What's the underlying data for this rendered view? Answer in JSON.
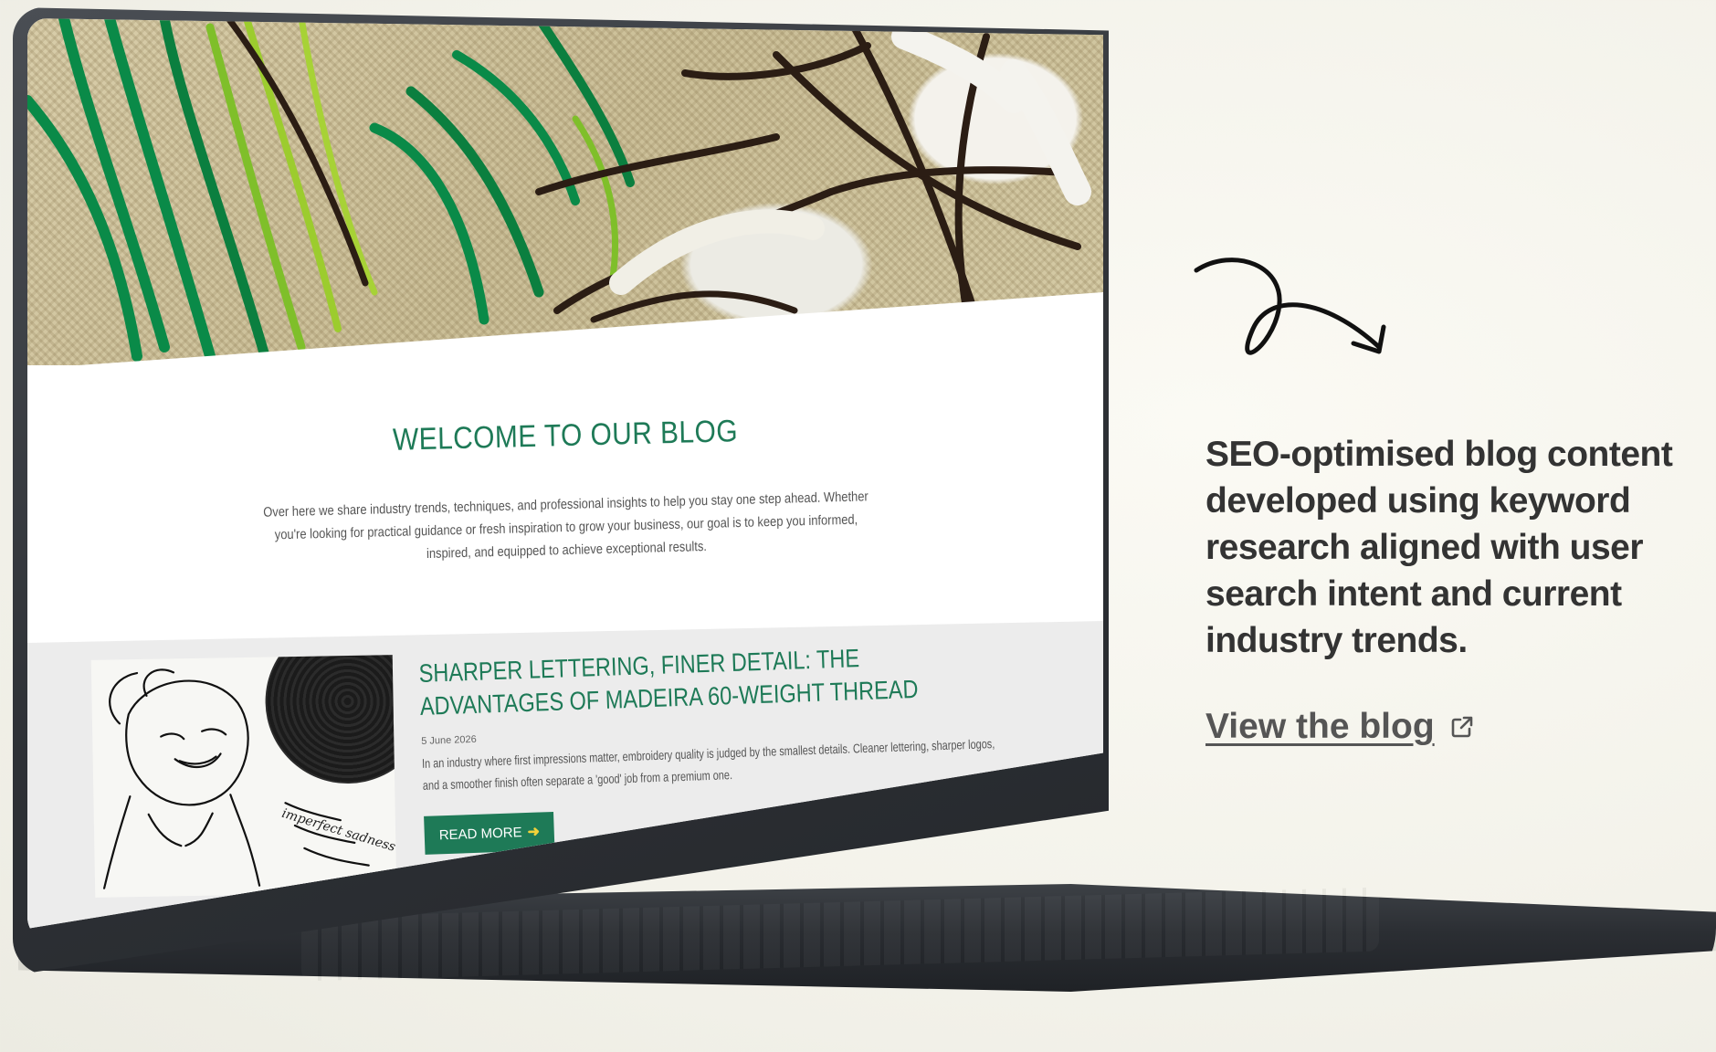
{
  "blog_page": {
    "welcome_title": "WELCOME TO OUR BLOG",
    "welcome_text": "Over here we share industry trends, techniques, and professional insights to help you stay one step ahead. Whether you're looking for practical guidance or fresh inspiration to grow your business, our goal is to keep you informed, inspired, and equipped to achieve exceptional results.",
    "post": {
      "title": "SHARPER LETTERING, FINER DETAIL: THE ADVANTAGES OF MADEIRA 60-WEIGHT THREAD",
      "date": "5 June 2026",
      "excerpt": "In an industry where first impressions matter, embroidery quality is judged by the smallest details. Cleaner lettering, sharper logos, and a smoother finish often separate a 'good' job from a premium one.",
      "read_more_label": "READ MORE",
      "thumbnail_caption": "imperfect sadness end-sth"
    }
  },
  "side_panel": {
    "description": "SEO-optimised blog content developed using keyword research aligned with user search intent and current industry trends.",
    "link_label": "View the blog",
    "link_icon": "external-link-icon"
  },
  "colors": {
    "brand_green": "#1e7a57",
    "accent_yellow": "#f2d23a",
    "text_dark": "#333333",
    "laptop_body": "#2e3136"
  }
}
